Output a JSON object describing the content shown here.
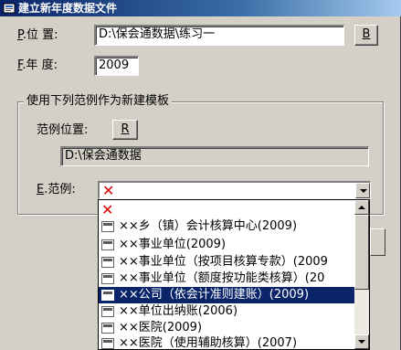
{
  "window": {
    "title": "建立新年度数据文件"
  },
  "form": {
    "location_label_hotkey": "P",
    "location_label": ".位  置:",
    "location_value": "D:\\保会通数据\\练习一",
    "browse_label": "B",
    "year_label_hotkey": "F",
    "year_label": ".年  度:",
    "year_value": "2009"
  },
  "template_group": {
    "title": "使用下列范例作为新建模板",
    "template_location_label": "范例位置:",
    "template_browse_label": "R",
    "template_location_value": "D:\\保会通数据",
    "template_label_hotkey": "E",
    "template_label": ".范例:",
    "template_selected_symbol": "✕"
  },
  "dropdown": {
    "items": [
      {
        "text": "✕",
        "type": "none"
      },
      {
        "text": "××乡（镇）会计核算中心(2009)",
        "type": "template"
      },
      {
        "text": "××事业单位(2009)",
        "type": "template"
      },
      {
        "text": "××事业单位（按项目核算专款）(2009",
        "type": "template"
      },
      {
        "text": "××事业单位（额度按功能类核算）(20",
        "type": "template"
      },
      {
        "text": "××公司（依会计准则建账）(2009)",
        "type": "template",
        "selected": true
      },
      {
        "text": "××单位出纳账(2006)",
        "type": "template"
      },
      {
        "text": "××医院(2009)",
        "type": "template"
      },
      {
        "text": "××医院（使用辅助核算）(2007)",
        "type": "template"
      }
    ],
    "icon_label": "csv",
    "selection_color": "#0a246a",
    "none_icon_color": "#e00000"
  }
}
